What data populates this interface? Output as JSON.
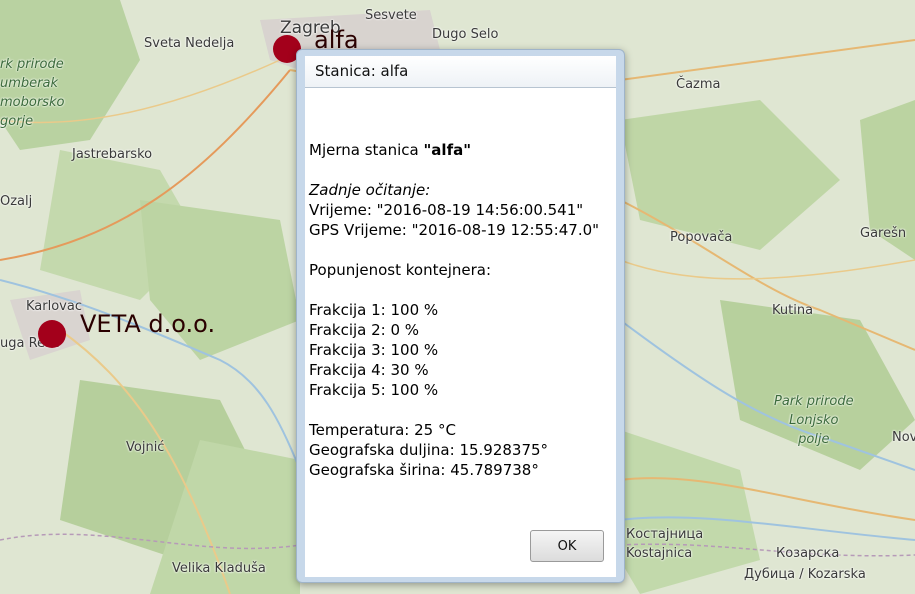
{
  "map": {
    "places": [
      {
        "name": "Zagreb"
      },
      {
        "name": "Sesvete"
      },
      {
        "name": "Sveta Nedelja"
      },
      {
        "name": "Dugo Selo"
      },
      {
        "name": "Čazma"
      },
      {
        "name": "Jastrebarsko"
      },
      {
        "name": "Ozalj"
      },
      {
        "name": "Popovača"
      },
      {
        "name": "Garešn"
      },
      {
        "name": "Karlovac"
      },
      {
        "name": "uga Resa"
      },
      {
        "name": "Kutina"
      },
      {
        "name": "Vojnić"
      },
      {
        "name": "Velika Kladuša"
      },
      {
        "name": "Костајница"
      },
      {
        "name": "Kostajnica"
      },
      {
        "name": "Козарска"
      },
      {
        "name": "Дубица / Kozarska"
      },
      {
        "name": "Nov"
      }
    ],
    "park_labels": [
      {
        "lines": [
          "rk prirode",
          "umberak",
          "moborsko",
          "gorje"
        ]
      },
      {
        "lines": [
          "Park prirode",
          "Lonjsko",
          "polje"
        ]
      }
    ],
    "markers": [
      {
        "label": "alfa",
        "color": "#a3001b"
      },
      {
        "label": "VETA d.o.o.",
        "color": "#a3001b"
      }
    ]
  },
  "dialog": {
    "title": "Stanica: alfa",
    "station_prefix": "Mjerna stanica ",
    "station_name": "\"alfa\"",
    "last_reading_label": "Zadnje očitanje:",
    "time": "Vrijeme: \"2016-08-19 14:56:00.541\"",
    "gps_time": "GPS Vrijeme: \"2016-08-19 12:55:47.0\"",
    "fill_label": "Popunjenost kontejnera:",
    "fractions": [
      "Frakcija 1: 100 %",
      "Frakcija 2: 0 %",
      "Frakcija 3: 100 %",
      "Frakcija 4: 30 %",
      "Frakcija 5: 100 %"
    ],
    "temperature": "Temperatura: 25 °C",
    "longitude": "Geografska duljina: 15.928375°",
    "latitude": "Geografska širina: 45.789738°",
    "ok_label": "OK"
  }
}
